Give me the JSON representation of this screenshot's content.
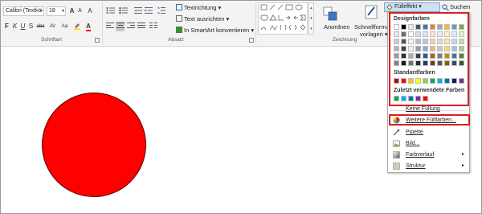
{
  "ribbon": {
    "font_name": "Calibri (Textkö",
    "font_size": "18",
    "groups": {
      "font": "Schriftart",
      "paragraph": "Absatz",
      "drawing": "Zeichnung"
    },
    "paragraph": {
      "text_direction": "Textrichtung",
      "align_text": "Text ausrichten",
      "smartart": "In SmartArt konvertieren"
    },
    "drawing": {
      "arrange": "Anordnen",
      "quick_styles_line1": "Schnellformat-",
      "quick_styles_line2": "vorlagen"
    },
    "fill_button": "Fülleffekt",
    "search": "Suchen",
    "font_buttons": {
      "bold": "F",
      "italic": "K",
      "underline": "U",
      "shadow": "S",
      "strike": "abc",
      "spacing": "AV",
      "case": "Aa",
      "grow": "A",
      "shrink": "A",
      "clear": "A",
      "font_color": "A"
    }
  },
  "fill_menu": {
    "theme_colors_heading": "Designfarben",
    "standard_colors_heading": "Standardfarben",
    "recent_colors_heading": "Zuletzt verwendete Farben",
    "no_fill": "Keine Füllung",
    "more_colors": "Weitere Füllfarben...",
    "eyedropper": "Pipette",
    "picture": "Bild...",
    "gradient": "Farbverlauf",
    "texture": "Struktur",
    "theme_colors": [
      "#ffffff",
      "#000000",
      "#e7e6e6",
      "#44546a",
      "#4472c4",
      "#ed7d31",
      "#a5a5a5",
      "#ffc000",
      "#5b9bd5",
      "#70ad47"
    ],
    "standard_colors": [
      "#c00000",
      "#ff0000",
      "#ffc000",
      "#ffff00",
      "#92d050",
      "#00b050",
      "#00b0f0",
      "#0070c0",
      "#002060",
      "#7030a0"
    ],
    "recent_colors": [
      "#00b050",
      "#00b0f0",
      "#0070c0",
      "#7030a0",
      "#ff0000"
    ]
  },
  "canvas": {
    "shape_fill": "#ff0000"
  }
}
